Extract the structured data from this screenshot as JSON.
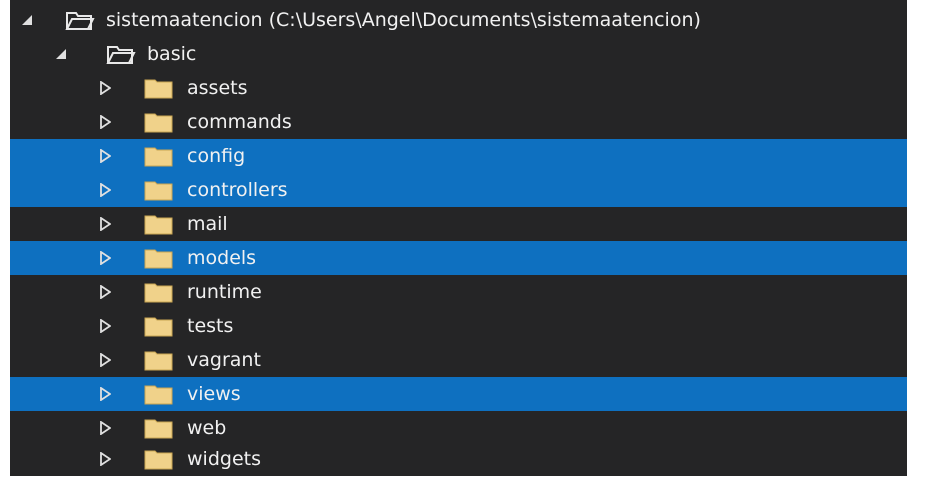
{
  "colors": {
    "panel_bg": "#252526",
    "selected_bg": "#0e70c0",
    "text": "#f1f1f1",
    "folder_fill": "#f0d28a",
    "folder_stroke": "#c9a552"
  },
  "tree": {
    "root": {
      "label": "sistemaatencion (C:\\Users\\Angel\\Documents\\sistemaatencion)",
      "expanded": true,
      "icon": "open-folder-icon"
    },
    "basic": {
      "label": "basic",
      "expanded": true,
      "icon": "open-folder-icon"
    },
    "folders": [
      {
        "label": "assets",
        "selected": false
      },
      {
        "label": "commands",
        "selected": false
      },
      {
        "label": "config",
        "selected": true
      },
      {
        "label": "controllers",
        "selected": true
      },
      {
        "label": "mail",
        "selected": false
      },
      {
        "label": "models",
        "selected": true
      },
      {
        "label": "runtime",
        "selected": false
      },
      {
        "label": "tests",
        "selected": false
      },
      {
        "label": "vagrant",
        "selected": false
      },
      {
        "label": "views",
        "selected": true
      },
      {
        "label": "web",
        "selected": false
      },
      {
        "label": "widgets",
        "selected": false
      }
    ]
  }
}
